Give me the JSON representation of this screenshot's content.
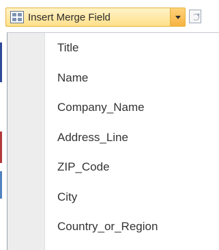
{
  "toolbar": {
    "split_button": {
      "icon": "merge-field-icon",
      "label": "Insert Merge Field",
      "arrow_icon": "chevron-down-icon"
    },
    "update_icon": "update-labels-icon",
    "accent_color": "#ffd27a"
  },
  "menu": {
    "items": [
      {
        "label": "Title"
      },
      {
        "label": "Name"
      },
      {
        "label": "Company_Name"
      },
      {
        "label": "Address_Line"
      },
      {
        "label": "ZIP_Code"
      },
      {
        "label": "City"
      },
      {
        "label": "Country_or_Region"
      }
    ]
  }
}
